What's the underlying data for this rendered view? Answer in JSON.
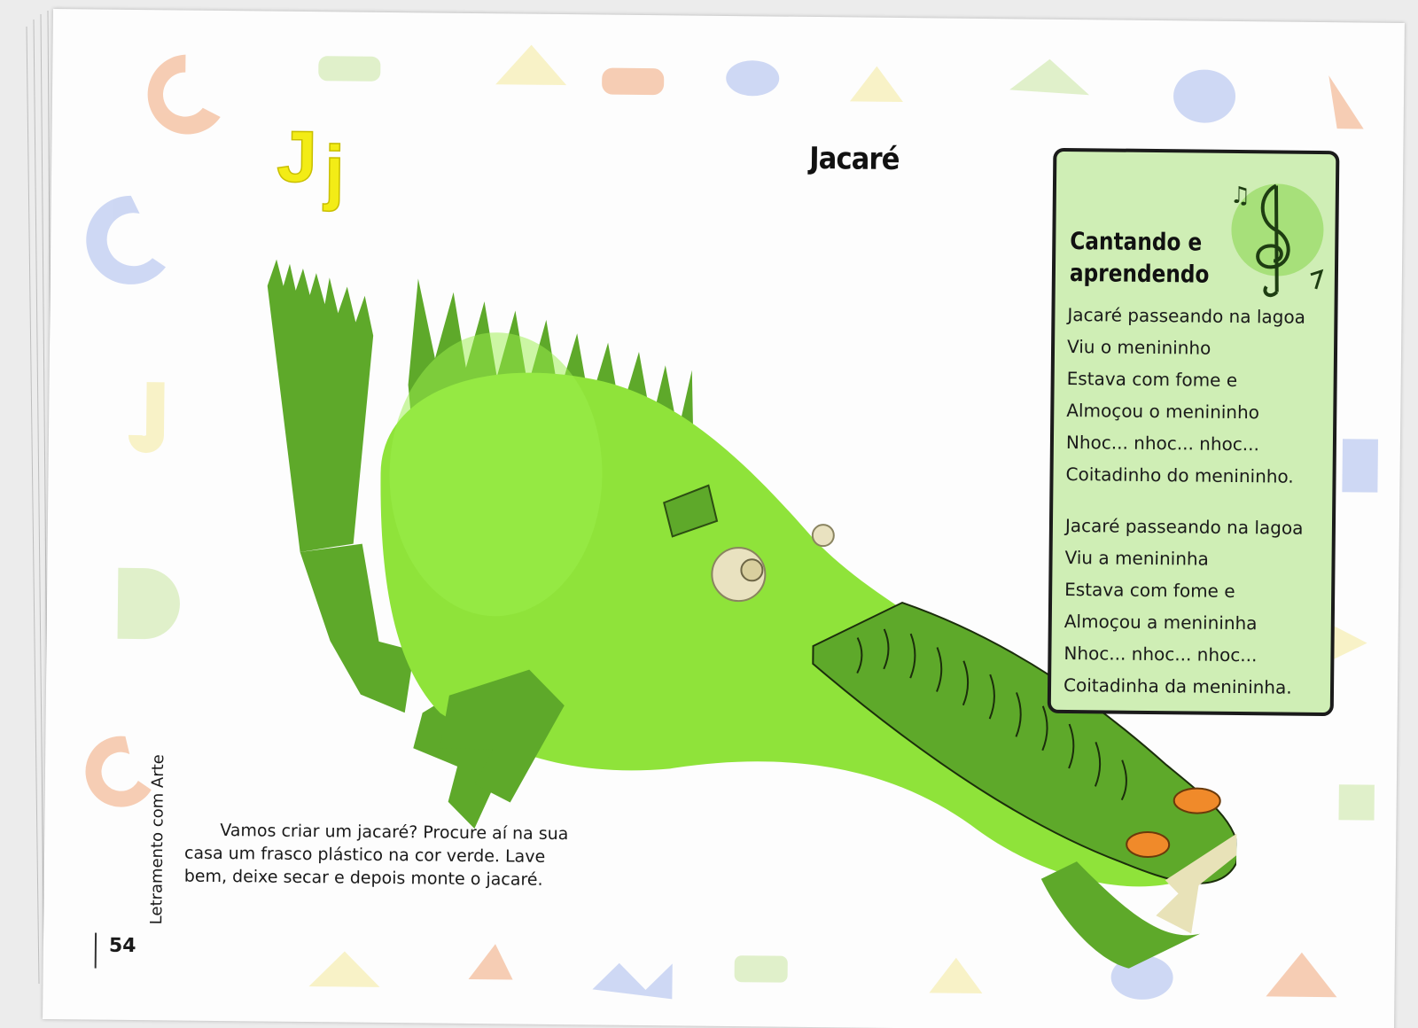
{
  "page": {
    "letter_upper": "J",
    "letter_lower": "j",
    "title": "Jacaré",
    "page_number": "54",
    "series_title": "Letramento com Arte"
  },
  "song": {
    "heading_line1": "Cantando e",
    "heading_line2": "aprendendo",
    "stanza1": [
      "Jacaré passeando na lagoa",
      "Viu o menininho",
      "Estava com fome e",
      "Almoçou o menininho",
      "Nhoc... nhoc... nhoc...",
      "Coitadinho do menininho."
    ],
    "stanza2": [
      "Jacaré passeando na lagoa",
      "Viu a menininha",
      "Estava com fome e",
      "Almoçou a menininha",
      "Nhoc... nhoc... nhoc...",
      "Coitadinha da menininha."
    ]
  },
  "intro": {
    "line1": "Vamos criar um jacaré? Procure aí na sua",
    "line2": "casa um frasco plástico na cor verde. Lave",
    "line3": "bem, deixe secar e depois monte o jacaré."
  },
  "icons": [
    "treble-clef-icon",
    "music-notes-icon"
  ],
  "colors": {
    "song_box": "#cfeeb5",
    "croc_light": "#8fe33a",
    "croc_dark": "#5ea92a",
    "letter_yellow": "#f3ec16"
  }
}
